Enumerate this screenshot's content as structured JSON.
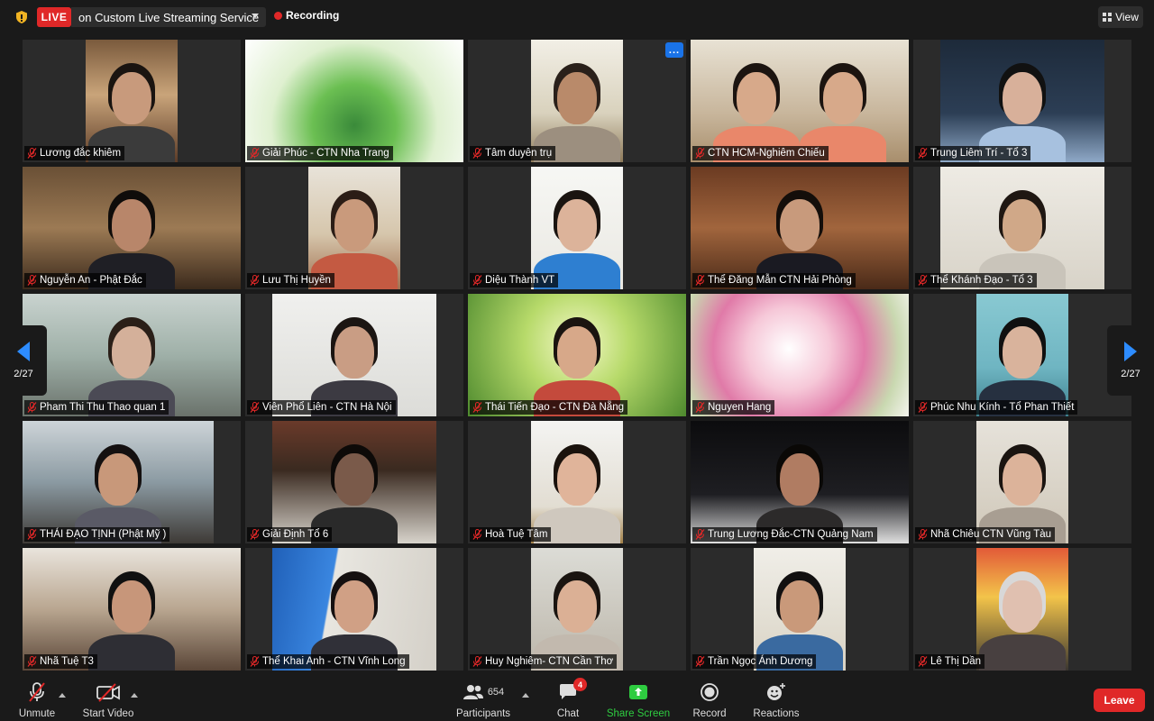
{
  "topbar": {
    "live_badge": "LIVE",
    "stream_service": "on Custom Live Streaming Service",
    "recording": "Recording",
    "view": "View"
  },
  "pager": {
    "left": "2/27",
    "right": "2/27"
  },
  "participants": [
    {
      "name": "Lương đắc khiêm"
    },
    {
      "name": "Giải Phúc - CTN Nha Trang"
    },
    {
      "name": "Tâm duyên trụ"
    },
    {
      "name": "CTN HCM-Nghiêm Chiếu"
    },
    {
      "name": "Trung Liêm Trí - Tổ 3"
    },
    {
      "name": "Nguyễn An - Phật Đắc"
    },
    {
      "name": "Lưu Thị Huyền"
    },
    {
      "name": "Diệu Thành VT"
    },
    {
      "name": "Thể Đăng Mẫn CTN Hải Phòng"
    },
    {
      "name": "Thể Khánh Đạo - Tổ 3"
    },
    {
      "name": "Pham Thi Thu Thao quan 1"
    },
    {
      "name": "Viên Phổ Liên - CTN Hà Nội"
    },
    {
      "name": "Thái Tiến Đạo - CTN Đà Nẵng"
    },
    {
      "name": "Nguyen Hang"
    },
    {
      "name": "Phúc Nhu Kính - Tổ Phan Thiết"
    },
    {
      "name": "THÁI ĐẠO TỊNH (Phật Mỹ )"
    },
    {
      "name": "Giải Định Tổ 6"
    },
    {
      "name": "Hoà Tuệ Tâm"
    },
    {
      "name": "Trung Lương Đắc-CTN Quảng Nam"
    },
    {
      "name": "Nhã Chiêu CTN Vũng Tàu"
    },
    {
      "name": "Nhã Tuệ T3"
    },
    {
      "name": "Thể Khai Anh - CTN Vĩnh Long"
    },
    {
      "name": "Huy Nghiêm- CTN Cần Thơ"
    },
    {
      "name": "Trần Ngọc Ánh Dương"
    },
    {
      "name": "Lê Thị Dần"
    }
  ],
  "tile_more_button": "...",
  "toolbar": {
    "unmute": "Unmute",
    "start_video": "Start Video",
    "participants_count": "654",
    "participants": "Participants",
    "chat": "Chat",
    "chat_badge": "4",
    "share_screen": "Share Screen",
    "record": "Record",
    "reactions": "Reactions",
    "leave": "Leave"
  },
  "colors": {
    "live_red": "#e02828",
    "accent_blue": "#2d8cff",
    "share_green": "#2ecc40",
    "background": "#1a1a1a"
  }
}
